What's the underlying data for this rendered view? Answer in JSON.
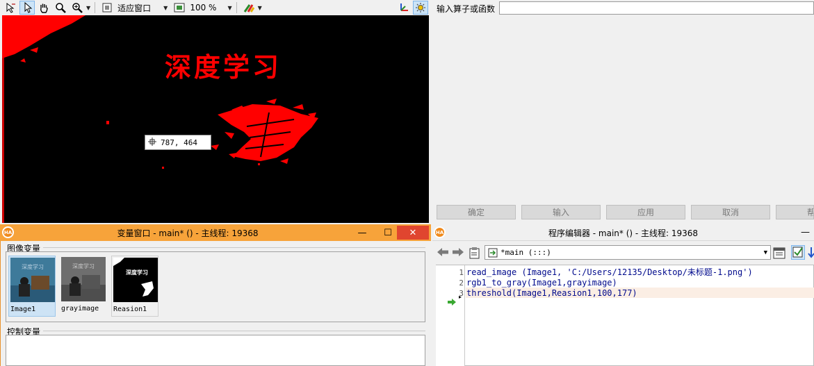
{
  "graphics": {
    "zoom_fit_label": "适应窗口",
    "zoom_percent": "100 %",
    "canvas_text": "深度学习",
    "coordinate_readout": "787, 464",
    "icons": [
      "cursor-icon",
      "pointer-icon",
      "hand-icon",
      "magnifier-icon",
      "zoom-in-icon",
      "fit-window-icon",
      "zoom-percent-icon",
      "palette-icon",
      "axis-icon",
      "settings-sun-icon"
    ]
  },
  "operator": {
    "label": "输入算子或函数",
    "input_value": "",
    "buttons": [
      "确定",
      "输入",
      "应用",
      "取消",
      "帮"
    ]
  },
  "variables": {
    "title": "变量窗口 - main* () - 主线程: 19368",
    "image_section": "图像变量",
    "control_section": "控制变量",
    "thumbnails": [
      {
        "name": "Image1",
        "overlay": "深度学习"
      },
      {
        "name": "grayimage",
        "overlay": "深度学习"
      },
      {
        "name": "Reasion1",
        "overlay": "深度学习"
      }
    ],
    "window_controls": {
      "minimize": "—",
      "maximize": "☐",
      "close": "✕"
    }
  },
  "program": {
    "title": "程序编辑器 - main* () - 主线程: 19368",
    "procedure": "*main (:::)",
    "lines": [
      {
        "num": "1",
        "code": "read_image (Image1, 'C:/Users/12135/Desktop/未标题-1.png')"
      },
      {
        "num": "2",
        "code": "rgb1_to_gray(Image1,grayimage)"
      },
      {
        "num": "3",
        "code": "threshold(Image1,Reasion1,100,177)"
      }
    ],
    "colors": {
      "code": "#000a8c",
      "pc_arrow": "#3aa832",
      "current_line_bg": "#fbeee4"
    }
  },
  "theme": {
    "accent": "#f7a33a",
    "canvas_bg": "#000000",
    "region_color": "#ff0000"
  }
}
